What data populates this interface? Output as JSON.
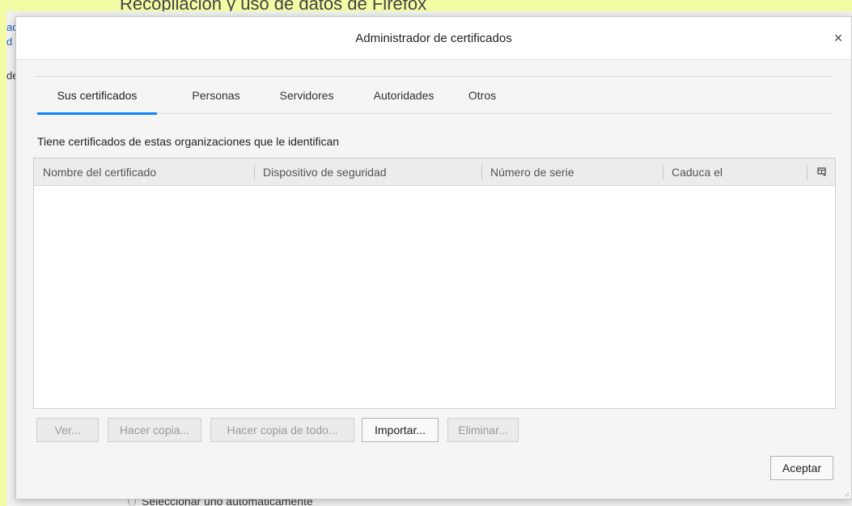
{
  "background": {
    "heading": "Recopilación y uso de datos de Firefox",
    "sidebar_fragments": [
      "ad",
      "d",
      "de"
    ],
    "bottom_option": "Seleccionar uno automáticamente"
  },
  "dialog": {
    "title": "Administrador de certificados",
    "close_glyph": "×"
  },
  "tabs": [
    {
      "label": "Sus certificados",
      "active": true
    },
    {
      "label": "Personas",
      "active": false
    },
    {
      "label": "Servidores",
      "active": false
    },
    {
      "label": "Autoridades",
      "active": false
    },
    {
      "label": "Otros",
      "active": false
    }
  ],
  "description": "Tiene certificados de estas organizaciones que le identifican",
  "table": {
    "columns": [
      "Nombre del certificado",
      "Dispositivo de seguridad",
      "Número de serie",
      "Caduca el"
    ],
    "rows": [],
    "column_picker_icon": "column-picker-icon"
  },
  "buttons": {
    "view": {
      "label": "Ver...",
      "enabled": false
    },
    "backup": {
      "label": "Hacer copia...",
      "enabled": false
    },
    "backup_all": {
      "label": "Hacer copia de todo...",
      "enabled": false
    },
    "import": {
      "label": "Importar...",
      "enabled": true
    },
    "delete": {
      "label": "Eliminar...",
      "enabled": false
    },
    "accept": {
      "label": "Aceptar",
      "enabled": true
    }
  },
  "colors": {
    "accent": "#0a84ff",
    "page_strip": "#f3fba5"
  }
}
